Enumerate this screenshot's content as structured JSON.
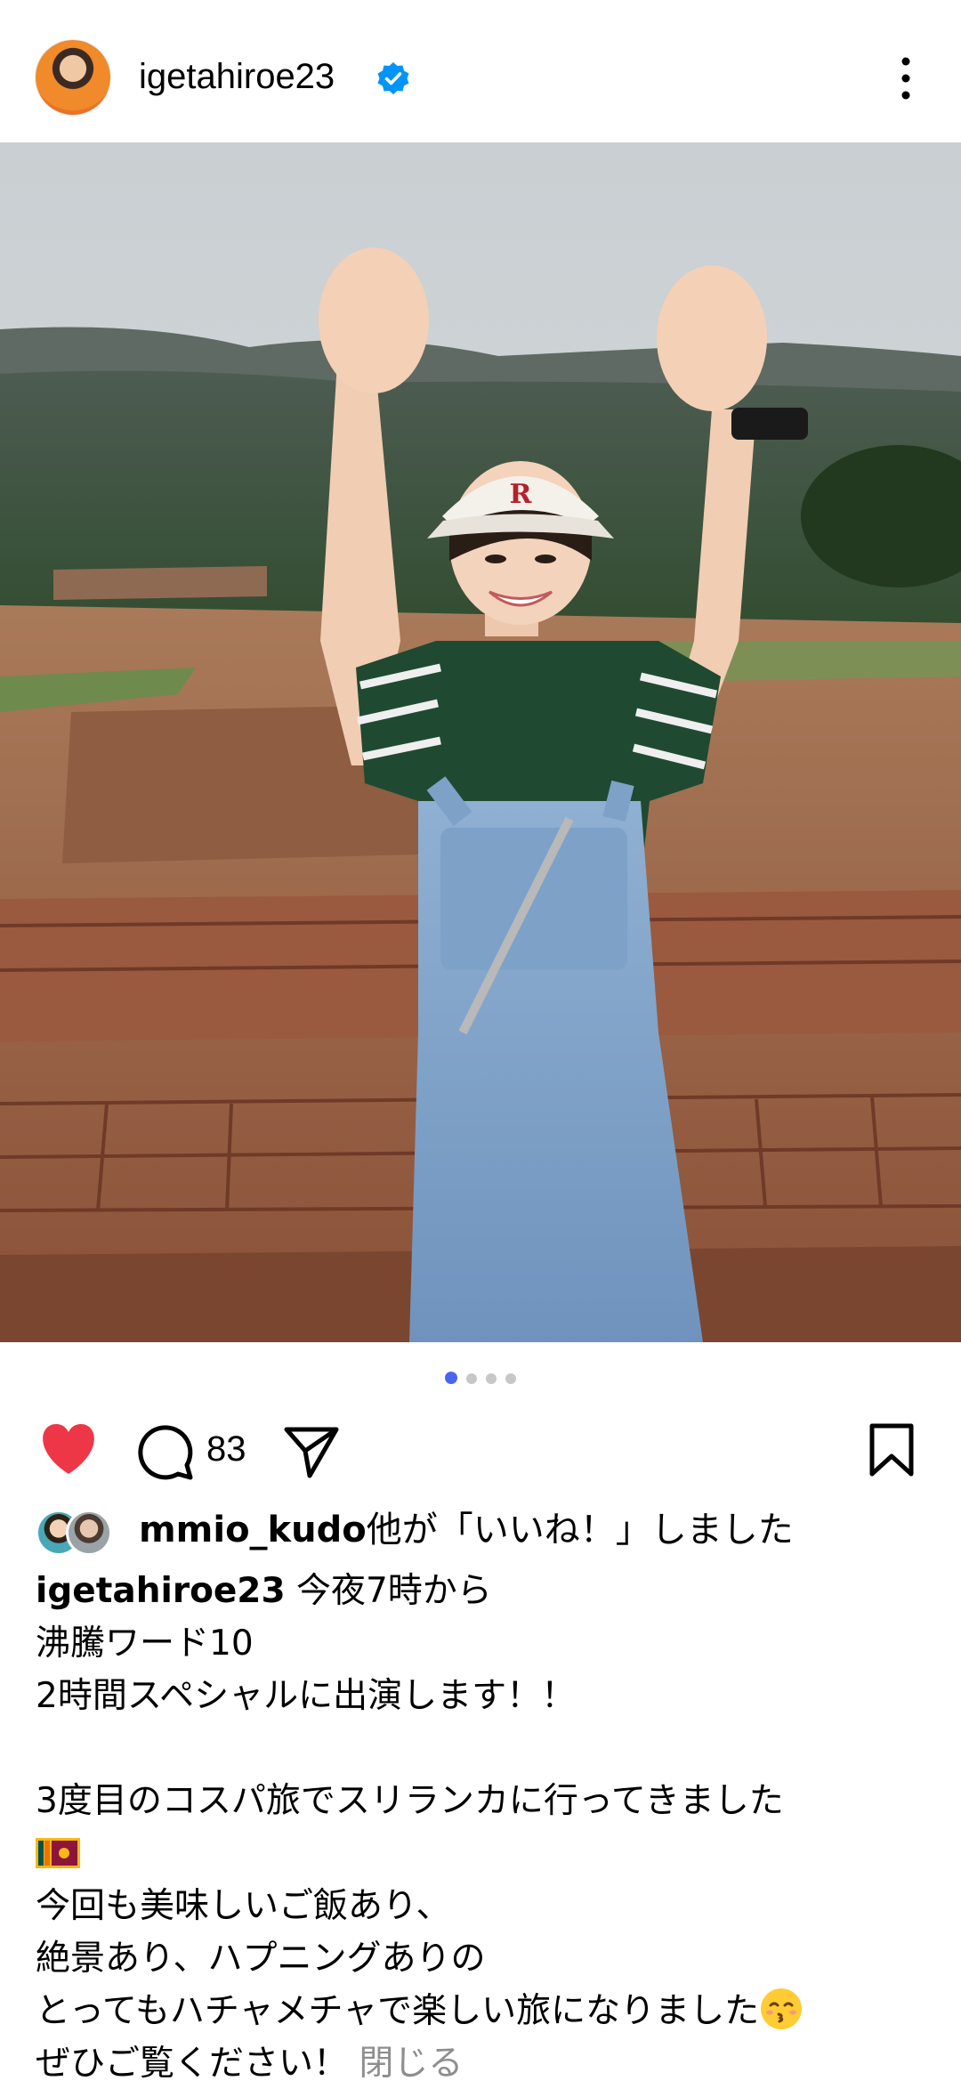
{
  "header": {
    "username": "igetahiroe23",
    "verified_icon": "verified-badge-icon",
    "more_icon": "more-vertical-icon"
  },
  "carousel": {
    "count": 4,
    "active_index": 0
  },
  "actions": {
    "like_icon": "heart-filled-icon",
    "like_color": "#ed3747",
    "comment_icon": "comment-icon",
    "comment_count": "83",
    "share_icon": "send-icon",
    "save_icon": "bookmark-icon"
  },
  "likes": {
    "user": "mmio_kudo",
    "suffix": "他が「いいね！」しました"
  },
  "caption": {
    "username": "igetahiroe23",
    "line1": " 今夜7時から",
    "line2": "沸騰ワード10",
    "line3": "2時間スペシャルに出演します！！",
    "line4": "3度目のコスパ旅でスリランカに行ってきました",
    "line5_icon": "sri-lanka-flag-icon",
    "line6": "今回も美味しいご飯あり、",
    "line7": "絶景あり、ハプニングありの",
    "line8": "とってもハチャメチャで楽しい旅になりました",
    "line8_icon": "kissing-face-icon",
    "line9": "ぜひご覧ください！",
    "close_label": "閉じる"
  },
  "colors": {
    "accent_blue": "#4a65f0",
    "verified_blue": "#0095f6",
    "muted_gray": "#8e8e8e"
  }
}
